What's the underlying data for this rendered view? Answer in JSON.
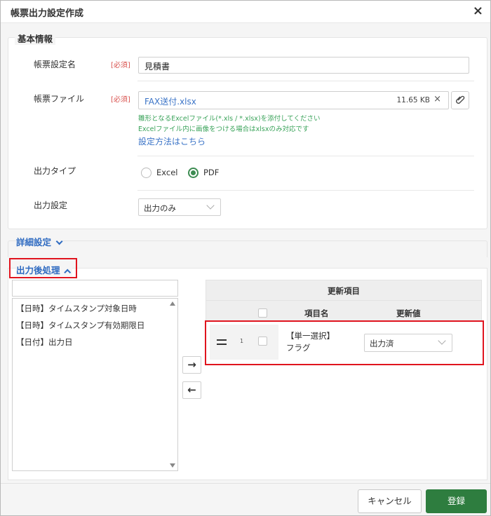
{
  "dialog": {
    "title": "帳票出力設定作成",
    "close_icon": "×"
  },
  "basic": {
    "section_title": "基本情報",
    "required_tag": "[必須]",
    "report_name": {
      "label": "帳票設定名",
      "value": "見積書"
    },
    "report_file": {
      "label": "帳票ファイル",
      "file_name": "FAX送付.xlsx",
      "file_size": "11.65 KB",
      "remove_icon": "×",
      "attach_icon": "paperclip-icon",
      "hint1": "雛形となるExcelファイル(*.xls / *.xlsx)を添付してください",
      "hint2": "Excelファイル内に画像をつける場合はxlsxのみ対応です",
      "help_link": "設定方法はこちら"
    },
    "output_type": {
      "label": "出力タイプ",
      "options": [
        "Excel",
        "PDF"
      ],
      "selected": "PDF"
    },
    "output_setting": {
      "label": "出力設定",
      "value": "出力のみ"
    }
  },
  "detail": {
    "title": "詳細設定"
  },
  "post_process": {
    "title": "出力後処理",
    "search_placeholder": "",
    "available_items": [
      "【日時】タイムスタンプ対象日時",
      "【日時】タイムスタンプ有効期限日",
      "【日付】出力日"
    ],
    "move_right_icon": "→",
    "move_left_icon": "←",
    "table": {
      "title": "更新項目",
      "col_item": "項目名",
      "col_value": "更新値",
      "rows": [
        {
          "num": "1",
          "item_line1": "【単一選択】",
          "item_line2": "フラグ",
          "value": "出力済"
        }
      ]
    }
  },
  "footer": {
    "cancel_label": "キャンセル",
    "save_label": "登録"
  },
  "colors": {
    "accent_green": "#2e7d3f",
    "link_blue": "#3b74c7",
    "hint_green": "#3aa35a",
    "required_red": "#d9534f",
    "highlight_red": "#e0141e"
  }
}
